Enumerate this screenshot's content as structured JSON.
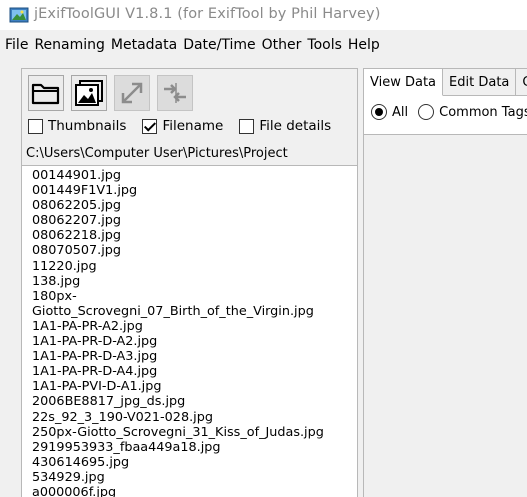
{
  "window": {
    "title": "jExifToolGUI V1.8.1  (for ExifTool by Phil Harvey)"
  },
  "menu": [
    "File",
    "Renaming",
    "Metadata",
    "Date/Time",
    "Other",
    "Tools",
    "Help"
  ],
  "toolbar": {
    "icons": [
      "folder-open-icon",
      "image-icon",
      "expand-icon",
      "compare-icon"
    ]
  },
  "options": {
    "thumbnails": {
      "label": "Thumbnails",
      "checked": false
    },
    "filename": {
      "label": "Filename",
      "checked": true
    },
    "file_details": {
      "label": "File details",
      "checked": false
    }
  },
  "path": "C:\\Users\\Computer User\\Pictures\\Project",
  "files": [
    "00144901.jpg",
    "001449F1V1.jpg",
    "08062205.jpg",
    "08062207.jpg",
    "08062218.jpg",
    "08070507.jpg",
    "11220.jpg",
    "138.jpg",
    "180px-",
    "Giotto_Scrovegni_07_Birth_of_the_Virgin.jpg",
    "1A1-PA-PR-A2.jpg",
    "1A1-PA-PR-D-A2.jpg",
    "1A1-PA-PR-D-A3.jpg",
    "1A1-PA-PR-D-A4.jpg",
    "1A1-PA-PVI-D-A1.jpg",
    "2006BE8817_jpg_ds.jpg",
    "22s_92_3_190-V021-028.jpg",
    "250px-Giotto_Scrovegni_31_Kiss_of_Judas.jpg",
    "2919953933_fbaa449a18.jpg",
    "430614695.jpg",
    "534929.jpg",
    "a000006f.jpg"
  ],
  "tabs": [
    "View Data",
    "Edit Data",
    "Copy"
  ],
  "view_filter": {
    "all": {
      "label": "All",
      "selected": true
    },
    "common": {
      "label": "Common Tags",
      "selected": false
    }
  }
}
